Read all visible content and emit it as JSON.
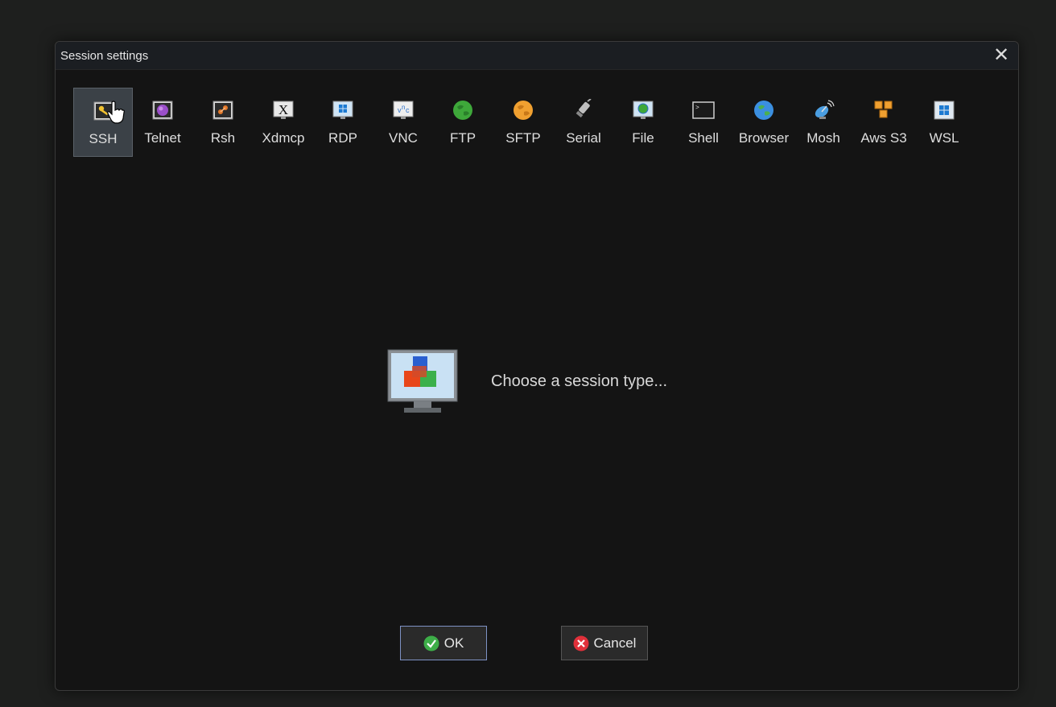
{
  "window": {
    "title": "Session settings"
  },
  "session_types": [
    {
      "label": "SSH",
      "icon": "key-icon",
      "selected": true
    },
    {
      "label": "Telnet",
      "icon": "telnet-icon"
    },
    {
      "label": "Rsh",
      "icon": "rsh-icon"
    },
    {
      "label": "Xdmcp",
      "icon": "xdmcp-icon"
    },
    {
      "label": "RDP",
      "icon": "rdp-icon"
    },
    {
      "label": "VNC",
      "icon": "vnc-icon"
    },
    {
      "label": "FTP",
      "icon": "ftp-globe-icon"
    },
    {
      "label": "SFTP",
      "icon": "sftp-globe-icon"
    },
    {
      "label": "Serial",
      "icon": "serial-plug-icon"
    },
    {
      "label": "File",
      "icon": "file-icon"
    },
    {
      "label": "Shell",
      "icon": "shell-terminal-icon"
    },
    {
      "label": "Browser",
      "icon": "browser-globe-icon"
    },
    {
      "label": "Mosh",
      "icon": "mosh-satellite-icon"
    },
    {
      "label": "Aws S3",
      "icon": "aws-s3-cubes-icon"
    },
    {
      "label": "WSL",
      "icon": "wsl-windows-icon"
    }
  ],
  "main": {
    "prompt": "Choose a session type..."
  },
  "buttons": {
    "ok_label": "OK",
    "cancel_label": "Cancel"
  },
  "colors": {
    "dialog_bg": "#141414",
    "selected_bg": "#3b4147",
    "ok_border": "#7e92c4"
  }
}
